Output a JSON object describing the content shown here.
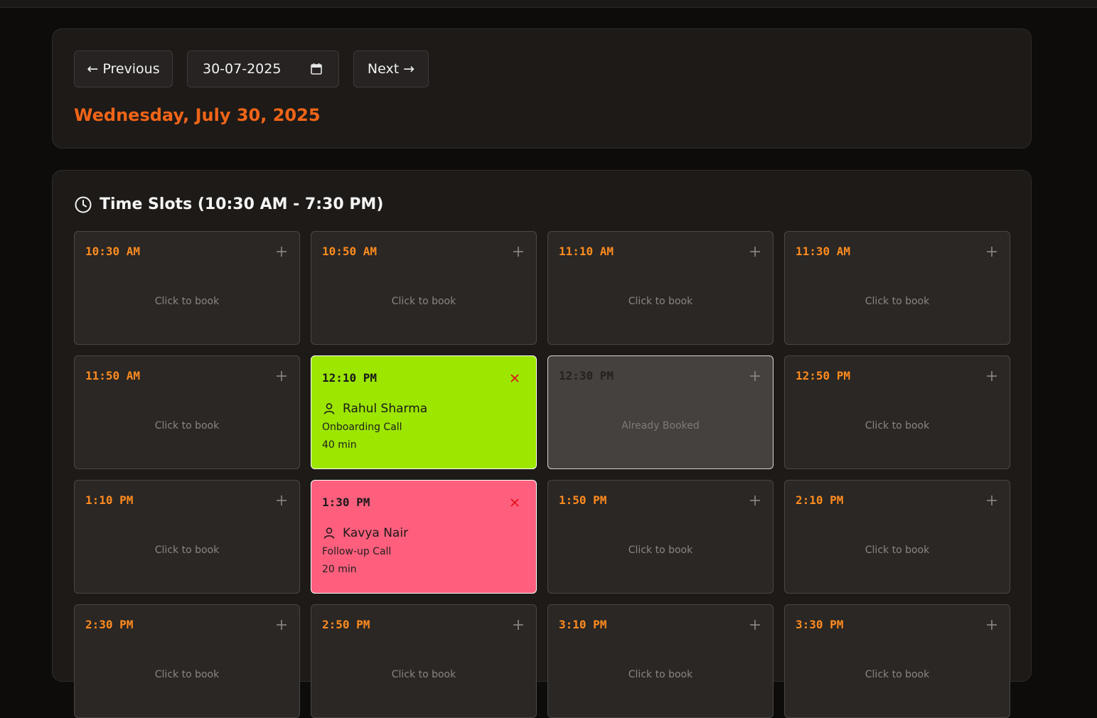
{
  "nav": {
    "previous_label": "← Previous",
    "date_value": "30-07-2025",
    "next_label": "Next →",
    "full_date": "Wednesday, July 30, 2025"
  },
  "slots_section": {
    "title": "Time Slots (10:30 AM - 7:30 PM)",
    "available_hint": "Click to book",
    "booked_elsewhere_hint": "Already Booked"
  },
  "colors": {
    "accent_orange": "#ff8b1e",
    "date_orange": "#f06417",
    "green_booking": "#9ce600",
    "pink_booking": "#ff5f7d",
    "cancel_red": "#e0131a"
  },
  "slots": [
    {
      "time": "10:30 AM",
      "status": "available"
    },
    {
      "time": "10:50 AM",
      "status": "available"
    },
    {
      "time": "11:10 AM",
      "status": "available"
    },
    {
      "time": "11:30 AM",
      "status": "available"
    },
    {
      "time": "11:50 AM",
      "status": "available"
    },
    {
      "time": "12:10 PM",
      "status": "booked",
      "client": "Rahul Sharma",
      "type": "Onboarding Call",
      "duration": "40 min",
      "color": "#9ce600"
    },
    {
      "time": "12:30 PM",
      "status": "blocked"
    },
    {
      "time": "12:50 PM",
      "status": "available"
    },
    {
      "time": "1:10 PM",
      "status": "available"
    },
    {
      "time": "1:30 PM",
      "status": "booked",
      "client": "Kavya Nair",
      "type": "Follow-up Call",
      "duration": "20 min",
      "color": "#ff5f7d"
    },
    {
      "time": "1:50 PM",
      "status": "available"
    },
    {
      "time": "2:10 PM",
      "status": "available"
    },
    {
      "time": "2:30 PM",
      "status": "available"
    },
    {
      "time": "2:50 PM",
      "status": "available"
    },
    {
      "time": "3:10 PM",
      "status": "available"
    },
    {
      "time": "3:30 PM",
      "status": "available"
    }
  ]
}
